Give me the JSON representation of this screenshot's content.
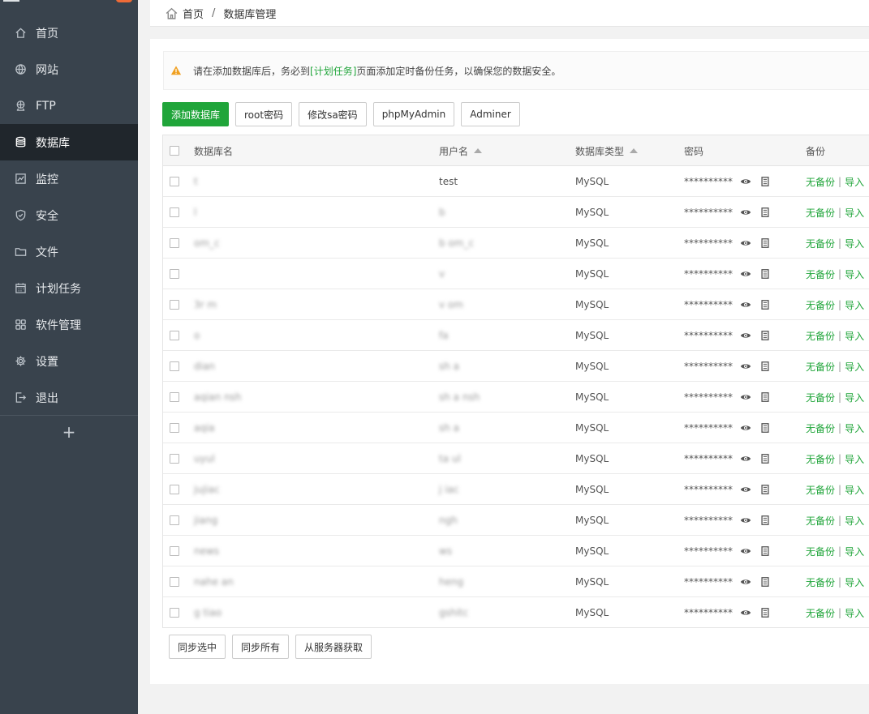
{
  "sidebar": {
    "items": [
      {
        "label": "首页",
        "icon": "home-icon"
      },
      {
        "label": "网站",
        "icon": "globe-icon"
      },
      {
        "label": "FTP",
        "icon": "ftp-icon"
      },
      {
        "label": "数据库",
        "icon": "database-icon",
        "active": true
      },
      {
        "label": "监控",
        "icon": "monitor-icon"
      },
      {
        "label": "安全",
        "icon": "shield-icon"
      },
      {
        "label": "文件",
        "icon": "folder-icon"
      },
      {
        "label": "计划任务",
        "icon": "calendar-icon"
      },
      {
        "label": "软件管理",
        "icon": "grid-icon"
      },
      {
        "label": "设置",
        "icon": "gear-icon"
      },
      {
        "label": "退出",
        "icon": "logout-icon"
      }
    ],
    "add_label": "+"
  },
  "breadcrumb": {
    "home": "首页",
    "separator": "/",
    "current": "数据库管理"
  },
  "notice": {
    "prefix": "请在添加数据库后，务必到",
    "link": "[计划任务]",
    "suffix": "页面添加定时备份任务，以确保您的数据安全。"
  },
  "toolbar": {
    "add_db": "添加数据库",
    "root_pwd": "root密码",
    "sa_pwd": "修改sa密码",
    "phpmyadmin": "phpMyAdmin",
    "adminer": "Adminer"
  },
  "table": {
    "headers": {
      "name": "数据库名",
      "user": "用户名",
      "type": "数据库类型",
      "password": "密码",
      "backup": "备份"
    },
    "rows": [
      {
        "name": "t",
        "user": "test",
        "type": "MySQL"
      },
      {
        "name": "l",
        "user": "b",
        "type": "MySQL"
      },
      {
        "name": "om_c",
        "user": "b om_c",
        "type": "MySQL"
      },
      {
        "name": "",
        "user": "v",
        "type": "MySQL"
      },
      {
        "name": "3r m",
        "user": "v om",
        "type": "MySQL"
      },
      {
        "name": "o",
        "user": "fa",
        "type": "MySQL"
      },
      {
        "name": "dian",
        "user": "sh a",
        "type": "MySQL"
      },
      {
        "name": "aqian nsh",
        "user": "sh a nsh",
        "type": "MySQL"
      },
      {
        "name": "aqia",
        "user": "sh a",
        "type": "MySQL"
      },
      {
        "name": "uyul",
        "user": "ta ul",
        "type": "MySQL"
      },
      {
        "name": "jujiac",
        "user": "j iac",
        "type": "MySQL"
      },
      {
        "name": "jiang",
        "user": "ngh",
        "type": "MySQL"
      },
      {
        "name": "news",
        "user": "ws",
        "type": "MySQL"
      },
      {
        "name": "nahe an",
        "user": "heng",
        "type": "MySQL"
      },
      {
        "name": "g tiao",
        "user": "gshitc",
        "type": "MySQL"
      }
    ],
    "password_mask": "**********",
    "backup_none": "无备份",
    "backup_sep": "|",
    "import": "导入"
  },
  "bottom": {
    "sync_selected": "同步选中",
    "sync_all": "同步所有",
    "from_server": "从服务器获取"
  },
  "colors": {
    "sidebar": "#39434d",
    "sidebar_active": "#20262c",
    "accent": "#20a53a",
    "badge": "#ef6b37",
    "warning": "#f0a020"
  }
}
